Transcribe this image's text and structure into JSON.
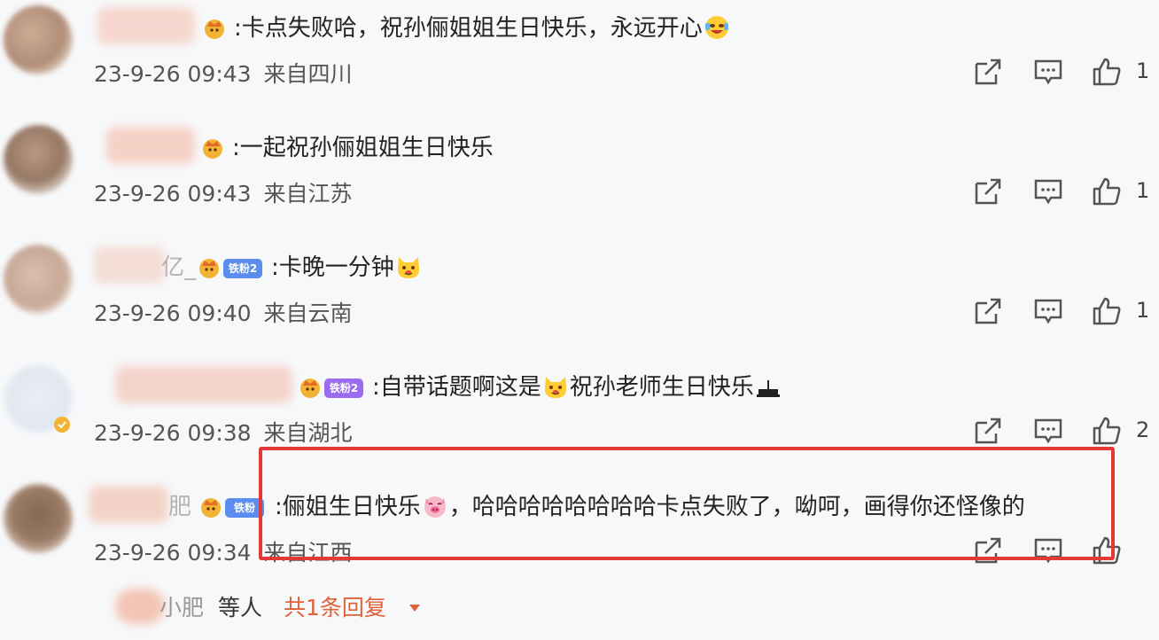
{
  "comments": [
    {
      "name_visible": "",
      "text_before": ":卡点失败哈，祝孙俪姐姐生日快乐，永远开心",
      "text_after": "",
      "emoji_icon": "face-joy-icon",
      "level_tag": "",
      "time": "23-9-26 09:43",
      "location": "来自四川",
      "likes": "1"
    },
    {
      "name_visible": "",
      "text_before": ":一起祝孙俪姐姐生日快乐",
      "text_after": "",
      "emoji_icon": "",
      "level_tag": "",
      "time": "23-9-26 09:43",
      "location": "来自江苏",
      "likes": "1"
    },
    {
      "name_visible": "亿_",
      "text_before": ":卡晚一分钟",
      "text_after": "",
      "emoji_icon": "cat-face-icon",
      "level_tag": "铁粉2",
      "time": "23-9-26 09:40",
      "location": "来自云南",
      "likes": "1"
    },
    {
      "name_visible": "",
      "text_before": ":自带话题啊这是",
      "text_after": "祝孙老师生日快乐",
      "emoji_icon": "cat-face-icon",
      "level_tag": "铁粉2",
      "time": "23-9-26 09:38",
      "location": "来自湖北",
      "likes": "2"
    },
    {
      "name_visible": "肥",
      "text_before": ":俪姐生日快乐",
      "text_after": "，哈哈哈哈哈哈哈哈卡点失败了，呦呵，画得你还怪像的",
      "emoji_icon": "pig-face-icon",
      "level_tag": "铁粉",
      "time": "23-9-26 09:34",
      "location": "来自江西",
      "likes": ""
    }
  ],
  "replies": {
    "name": "小肥",
    "etc": "等人",
    "count_label": "共1条回复"
  },
  "colors": {
    "accent_orange": "#e0623a",
    "highlight_red": "#e53935",
    "icon_gray": "#555555",
    "level_blue": "#5b8def",
    "level_purple": "#9b6cf0",
    "badge_gold": "#f2b233"
  }
}
